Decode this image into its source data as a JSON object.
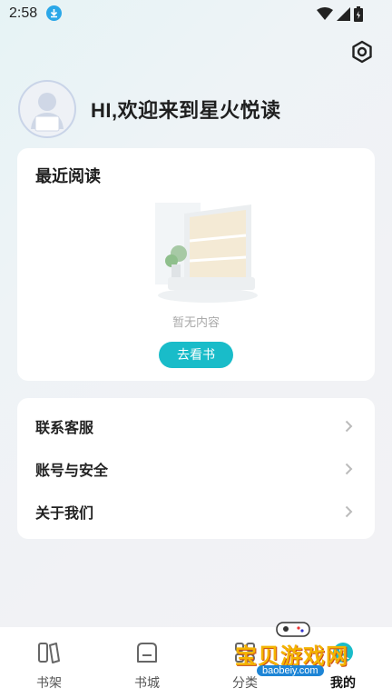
{
  "status_bar": {
    "time": "2:58"
  },
  "profile": {
    "greeting": "HI,欢迎来到星火悦读"
  },
  "recent": {
    "title": "最近阅读",
    "empty_text": "暂无内容",
    "action_label": "去看书"
  },
  "menu": {
    "items": [
      {
        "label": "联系客服"
      },
      {
        "label": "账号与安全"
      },
      {
        "label": "关于我们"
      }
    ]
  },
  "tabbar": {
    "tabs": [
      {
        "label": "书架",
        "icon": "bookshelf-icon"
      },
      {
        "label": "书城",
        "icon": "bookstore-icon"
      },
      {
        "label": "分类",
        "icon": "category-icon"
      },
      {
        "label": "我的",
        "icon": "profile-icon"
      }
    ],
    "active_index": 3
  },
  "watermark": {
    "text": "宝贝游戏网",
    "url": "baobeiy.com"
  },
  "colors": {
    "accent": "#19bcc9",
    "card": "#ffffff",
    "badge": "#2aa7e8"
  }
}
